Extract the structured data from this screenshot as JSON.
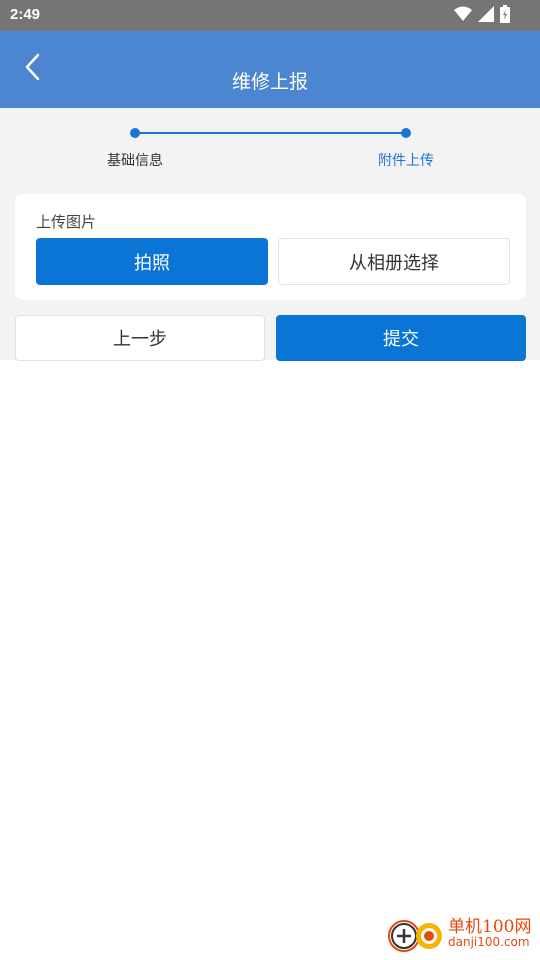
{
  "status_bar": {
    "time": "2:49"
  },
  "header": {
    "title": "维修上报"
  },
  "steps": [
    {
      "label": "基础信息",
      "active": false
    },
    {
      "label": "附件上传",
      "active": true
    }
  ],
  "upload": {
    "label": "上传图片",
    "take_photo_label": "拍照",
    "album_label": "从相册选择"
  },
  "actions": {
    "prev_label": "上一步",
    "submit_label": "提交"
  },
  "watermark": {
    "title": "单机100网",
    "url": "danji100.com"
  },
  "colors": {
    "status_bar": "#757575",
    "app_bar": "#4c86d0",
    "primary": "#0b75d6",
    "background": "#f3f3f3",
    "step_active_text": "#1c74d4"
  }
}
